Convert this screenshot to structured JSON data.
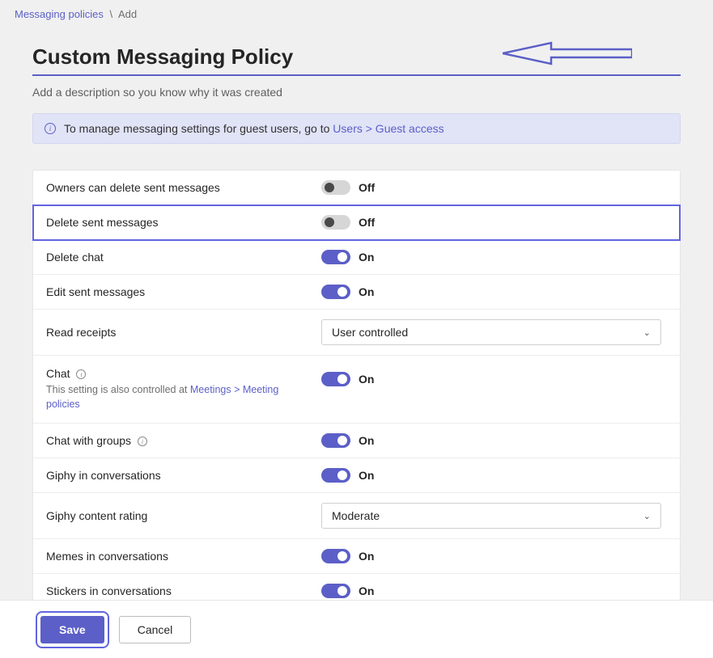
{
  "breadcrumb": {
    "parent": "Messaging policies",
    "separator": "\\",
    "current": "Add"
  },
  "title": "Custom Messaging Policy",
  "description": "Add a description so you know why it was created",
  "infoBanner": {
    "text": "To manage messaging settings for guest users, go to ",
    "link": "Users > Guest access"
  },
  "settings": {
    "ownersDelete": {
      "label": "Owners can delete sent messages",
      "state": "Off"
    },
    "deleteSent": {
      "label": "Delete sent messages",
      "state": "Off"
    },
    "deleteChat": {
      "label": "Delete chat",
      "state": "On"
    },
    "editSent": {
      "label": "Edit sent messages",
      "state": "On"
    },
    "readReceipts": {
      "label": "Read receipts",
      "value": "User controlled"
    },
    "chat": {
      "label": "Chat",
      "subPrefix": "This setting is also controlled at ",
      "subLink": "Meetings > Meeting policies",
      "state": "On"
    },
    "chatGroups": {
      "label": "Chat with groups",
      "state": "On"
    },
    "giphy": {
      "label": "Giphy in conversations",
      "state": "On"
    },
    "giphyRating": {
      "label": "Giphy content rating",
      "value": "Moderate"
    },
    "memes": {
      "label": "Memes in conversations",
      "state": "On"
    },
    "stickers": {
      "label": "Stickers in conversations",
      "state": "On"
    }
  },
  "footer": {
    "save": "Save",
    "cancel": "Cancel"
  }
}
